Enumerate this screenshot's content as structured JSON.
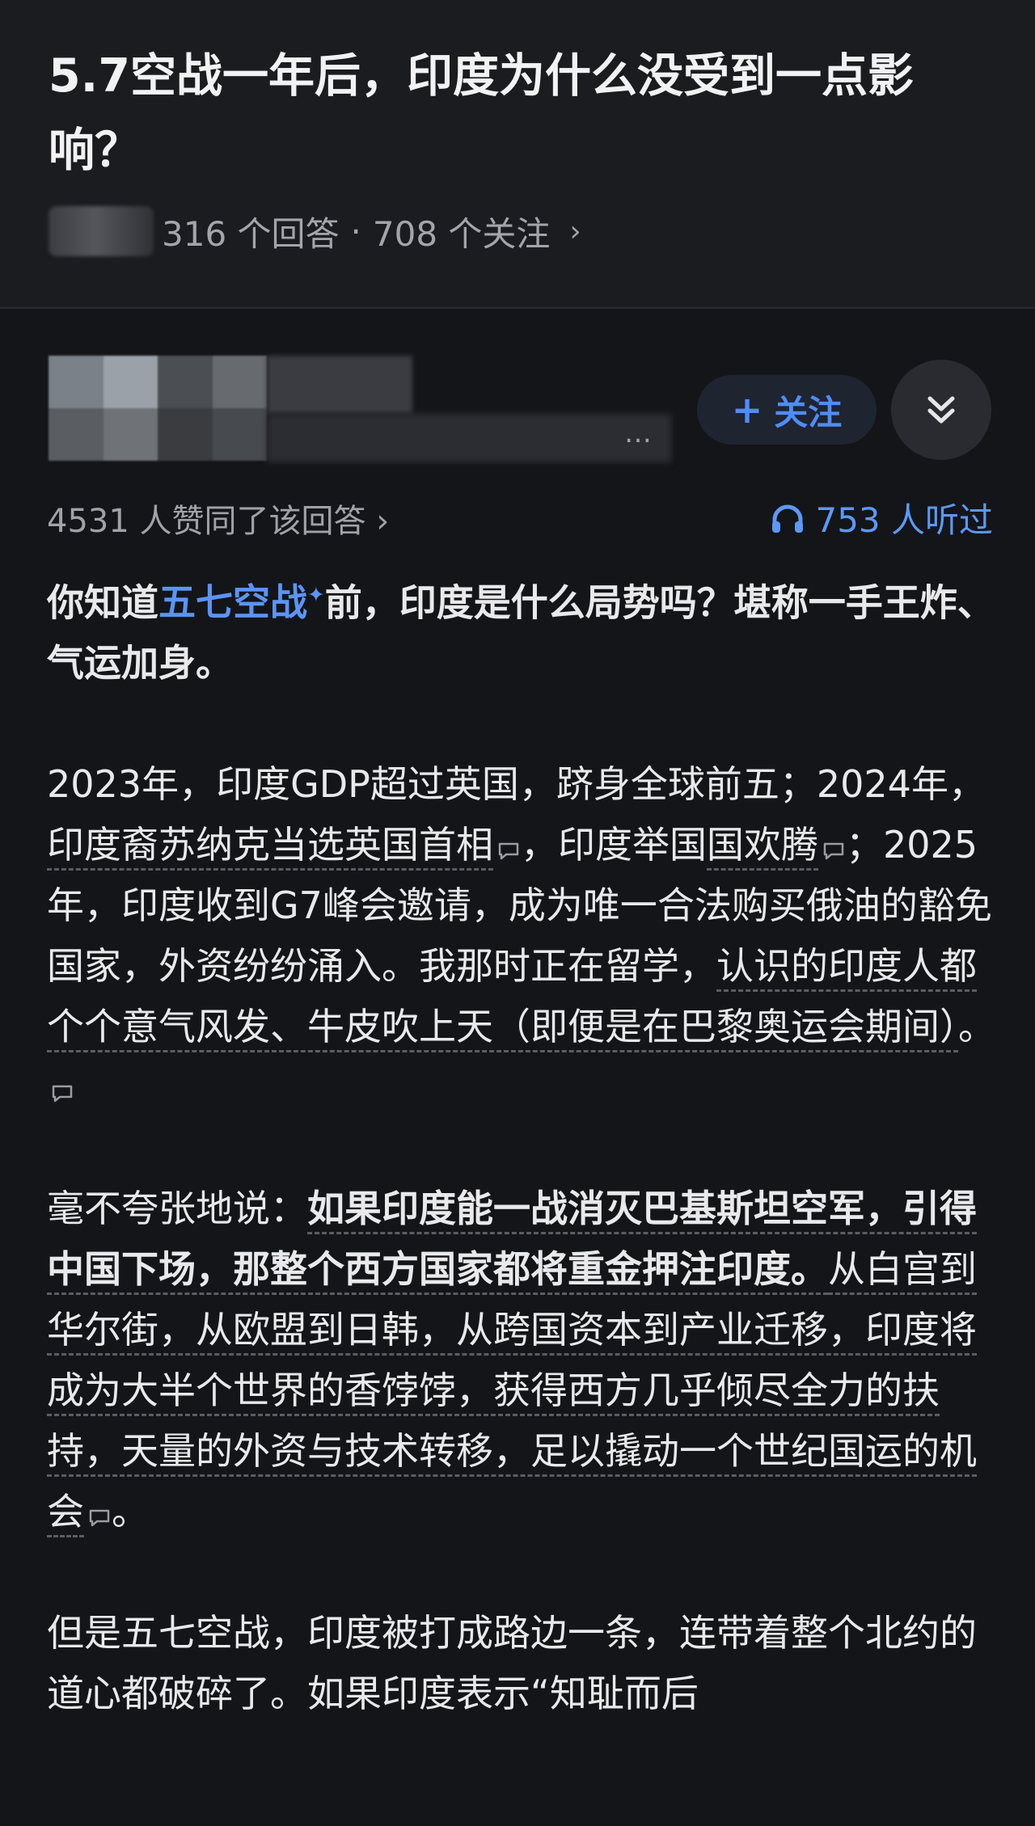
{
  "question": {
    "title": "5.7空战一年后，印度为什么没受到一点影响？",
    "answers": "316 个回答",
    "separator": "·",
    "followers": "708 个关注",
    "chevron": "›"
  },
  "author": {
    "ellipsis": "…",
    "follow_plus": "+",
    "follow_label": "关注",
    "collapse_icon": "double-chevron-down-icon"
  },
  "stats": {
    "likes": "4531 人赞同了该回答 ›",
    "listen_count": "753 人听过",
    "listen_icon": "headphones-icon"
  },
  "answer": {
    "p1": {
      "a": "你知道",
      "link": "五七空战",
      "sup": "✦",
      "b": "前，印度是什么局势吗？堪称一手王炸、气运加身。"
    },
    "p2": {
      "s1": "2023年，印度GDP超过英国，跻身全球前五；2024年，",
      "u1": "印度裔苏纳克当选英国首相",
      "s2": "，印度举国",
      "u2": "国欢腾",
      "s3": "；2025年，印度收到G7峰会邀请，成为唯一合法购买俄油的豁免国家，外资纷纷涌入。我那时正在留学，",
      "u3": "认识的印度人都个个意气风发、牛皮吹上天（即便是在巴黎奥运会期间）",
      "s4": "。"
    },
    "p3": {
      "s1": "毫不夸张地说：",
      "bold": "如果印度能一战消灭巴基斯坦空军，引得中国下场，那整个西方国家都将重金押注印度。",
      "u1": "从白宫到华尔街，从欧盟到日韩，从跨国资本到产业迁移，印度将成为大半个世界的香饽饽，获得西方几乎倾尽全力的扶持，天量的外资与技术转移，足以撬动一个世纪国运的机会",
      "s2": "。"
    },
    "p4": {
      "text": "但是五七空战，印度被打成路边一条，连带着整个北约的道心都破碎了。如果印度表示“知耻而后"
    }
  },
  "colors": {
    "background": "#141518",
    "header": "#1b1c20",
    "accent": "#4f8df6",
    "text": "#ececee",
    "muted": "#a0a2a8"
  }
}
